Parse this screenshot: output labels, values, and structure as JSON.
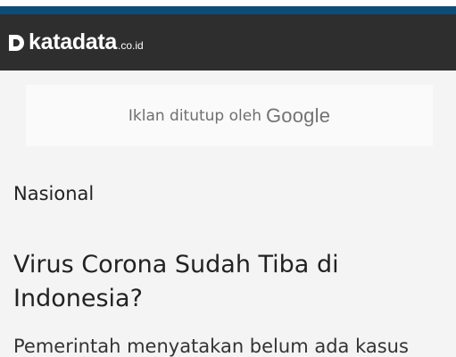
{
  "header": {
    "logo_text": "katadata",
    "logo_tld": ".co.id",
    "brand_color": "#0c4c79",
    "header_bg": "#2e2e2e"
  },
  "ad": {
    "closed_text": "Iklan ditutup oleh",
    "brand": "Google"
  },
  "article": {
    "category": "Nasional",
    "title": "Virus Corona Sudah Tiba di Indonesia?",
    "lead": "Pemerintah menyatakan belum ada kasus"
  }
}
